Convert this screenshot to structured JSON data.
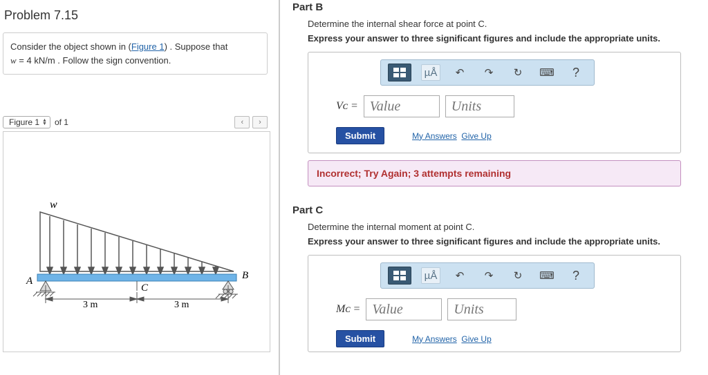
{
  "problem": {
    "title": "Problem 7.15",
    "desc_prefix": "Consider the object shown in (",
    "figure_link": "Figure 1",
    "desc_mid": ") . Suppose that ",
    "var_w": "w",
    "eq1": " = 4  kN/m",
    "desc_suffix": " . Follow the sign convention."
  },
  "figure_nav": {
    "selector": "Figure 1",
    "of_text": "of 1",
    "prev": "‹",
    "next": "›"
  },
  "figure_labels": {
    "w": "w",
    "A": "A",
    "B": "B",
    "C": "C",
    "dim": "3 m"
  },
  "toolbar": {
    "tmpl": "templates-icon",
    "ua": "µÅ",
    "undo": "↶",
    "redo": "↷",
    "reset": "↻",
    "kbd": "⌨",
    "help": "?"
  },
  "common": {
    "value_ph": "Value",
    "units_ph": "Units",
    "submit": "Submit",
    "my_answers": "My Answers",
    "give_up": "Give Up"
  },
  "partB": {
    "title": "Part B",
    "instr": "Determine the internal shear force at point C.",
    "instr2": "Express your answer to three significant figures and include the appropriate units.",
    "var_label": "Vᴄ =",
    "error": "Incorrect; Try Again; 3 attempts remaining"
  },
  "partC": {
    "title": "Part C",
    "instr": "Determine the internal moment at point C.",
    "instr2": "Express your answer to three significant figures and include the appropriate units.",
    "var_label": "Mᴄ ="
  }
}
